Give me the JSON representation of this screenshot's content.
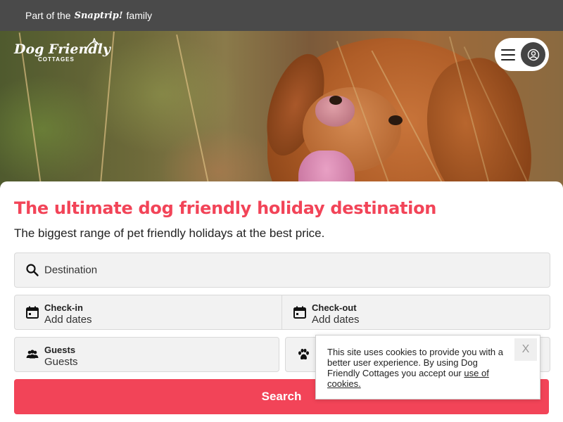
{
  "topbar": {
    "prefix": "Part of the",
    "brand": "Snaptrip!",
    "suffix": "family"
  },
  "logo": {
    "line1": "Dog Friendly",
    "line2": "COTTAGES"
  },
  "hero": {
    "title": "The ultimate dog friendly holiday destination",
    "subtitle": "The biggest range of pet friendly holidays at the best price."
  },
  "search": {
    "destination_placeholder": "Destination",
    "checkin_label": "Check-in",
    "checkin_value": "Add dates",
    "checkout_label": "Check-out",
    "checkout_value": "Add dates",
    "guests_label": "Guests",
    "guests_value": "Guests",
    "button_label": "Search"
  },
  "cookie": {
    "text": "This site uses cookies to provide you with a better user experience. By using Dog Friendly Cottages you accept our",
    "link": "use of cookies.",
    "close_label": "X"
  },
  "colors": {
    "accent": "#f24458",
    "topbar": "#4a4a4a",
    "field_bg": "#f2f2f2"
  },
  "icons": [
    "search-icon",
    "calendar-icon",
    "guests-icon",
    "paw-icon",
    "menu-icon",
    "user-icon"
  ]
}
